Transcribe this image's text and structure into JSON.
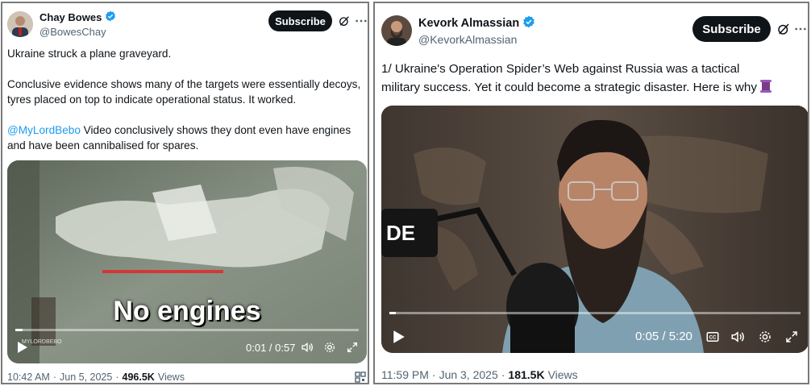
{
  "left_tweet": {
    "author_name": "Chay Bowes",
    "author_handle": "@BowesChay",
    "subscribe_label": "Subscribe",
    "text_line1": "Ukraine struck a plane graveyard.",
    "text_line2": "Conclusive evidence shows many of the targets were essentially decoys, tyres placed on top to indicate operational status. It worked.",
    "mention": "@MyLordBebo",
    "text_line3": " Video conclusively shows they dont even have engines and have been cannibalised for spares.",
    "video_caption": "No engines",
    "video_watermark": "MYLORDBEBO",
    "video_time": "0:01 / 0:57",
    "video_progress": 0.02,
    "time": "10:42 AM",
    "date": "Jun 5, 2025",
    "views_count": "496.5K",
    "views_label": "Views",
    "separator": "·"
  },
  "right_tweet": {
    "author_name": "Kevork Almassian",
    "author_handle": "@KevorkAlmassian",
    "subscribe_label": "Subscribe",
    "text_line1": "1/ Ukraine's Operation Spider’s Web against Russia was a tactical",
    "text_line2": "military success. Yet it could become a strategic disaster. Here is why",
    "mic_label": "DE",
    "video_time": "0:05 / 5:20",
    "video_progress": 0.016,
    "time": "11:59 PM",
    "date": "Jun 3, 2025",
    "views_count": "181.5K",
    "views_label": "Views",
    "separator": "·"
  },
  "colors": {
    "verified": "#1d9bf0",
    "mention": "#1d9bf0",
    "text": "#0f1419",
    "muted": "#536471",
    "button": "#0f1419"
  },
  "icons": [
    "verified-badge-icon",
    "grok-icon",
    "more-icon",
    "play-icon",
    "captions-icon",
    "volume-icon",
    "settings-icon",
    "fullscreen-icon",
    "scroll-icon",
    "qr-icon"
  ]
}
